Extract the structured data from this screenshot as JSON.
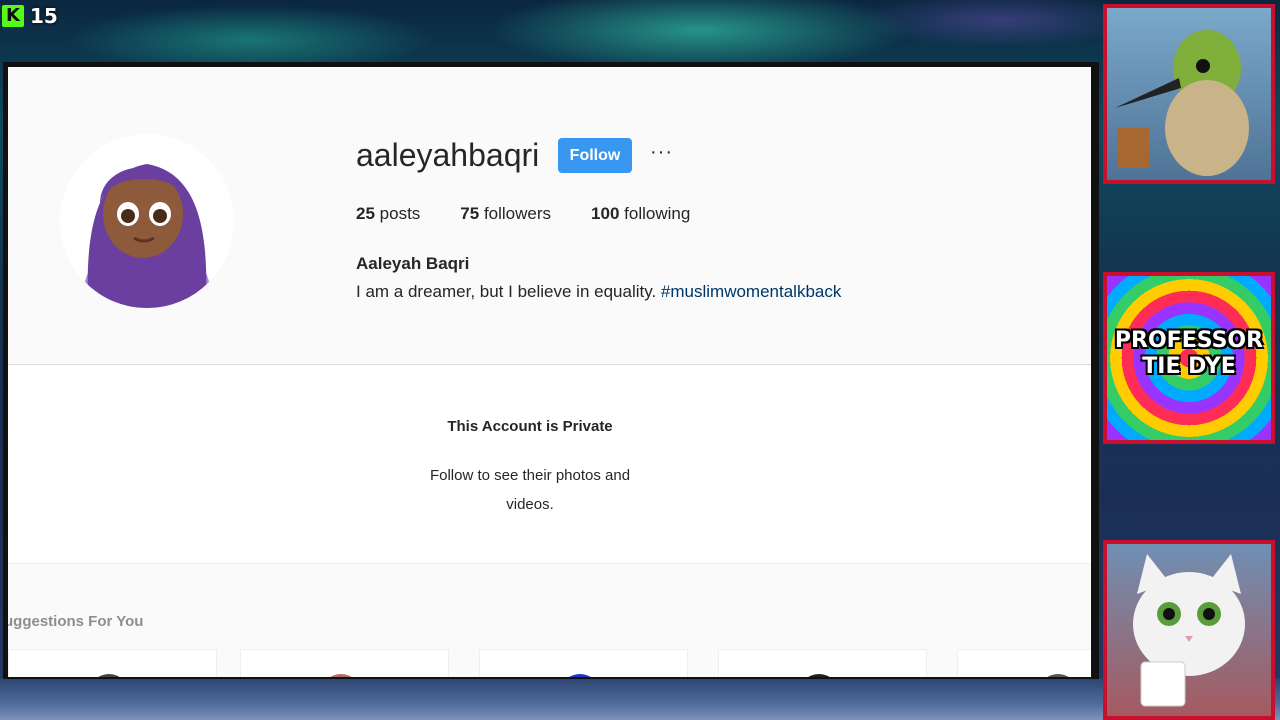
{
  "stream": {
    "viewer_count": "15"
  },
  "profile": {
    "username": "aaleyahbaqri",
    "follow_label": "Follow",
    "more_label": "···",
    "stats": [
      {
        "count": "25",
        "label": "posts"
      },
      {
        "count": "75",
        "label": "followers"
      },
      {
        "count": "100",
        "label": "following"
      }
    ],
    "full_name": "Aaleyah Baqri",
    "bio_text": "I am a dreamer, but I believe in equality. ",
    "bio_hashtag": "#muslimwomentalkback"
  },
  "private": {
    "title": "This Account is Private",
    "subtitle": "Follow to see their photos and videos."
  },
  "suggestions": {
    "title": "uggestions For You"
  },
  "overlay": {
    "banner_line1": "PROFESSOR",
    "banner_line2": "TIE DYE"
  },
  "colors": {
    "follow_button": "#3897f0",
    "hashtag": "#003569",
    "kick_brand": "#53fc18"
  }
}
